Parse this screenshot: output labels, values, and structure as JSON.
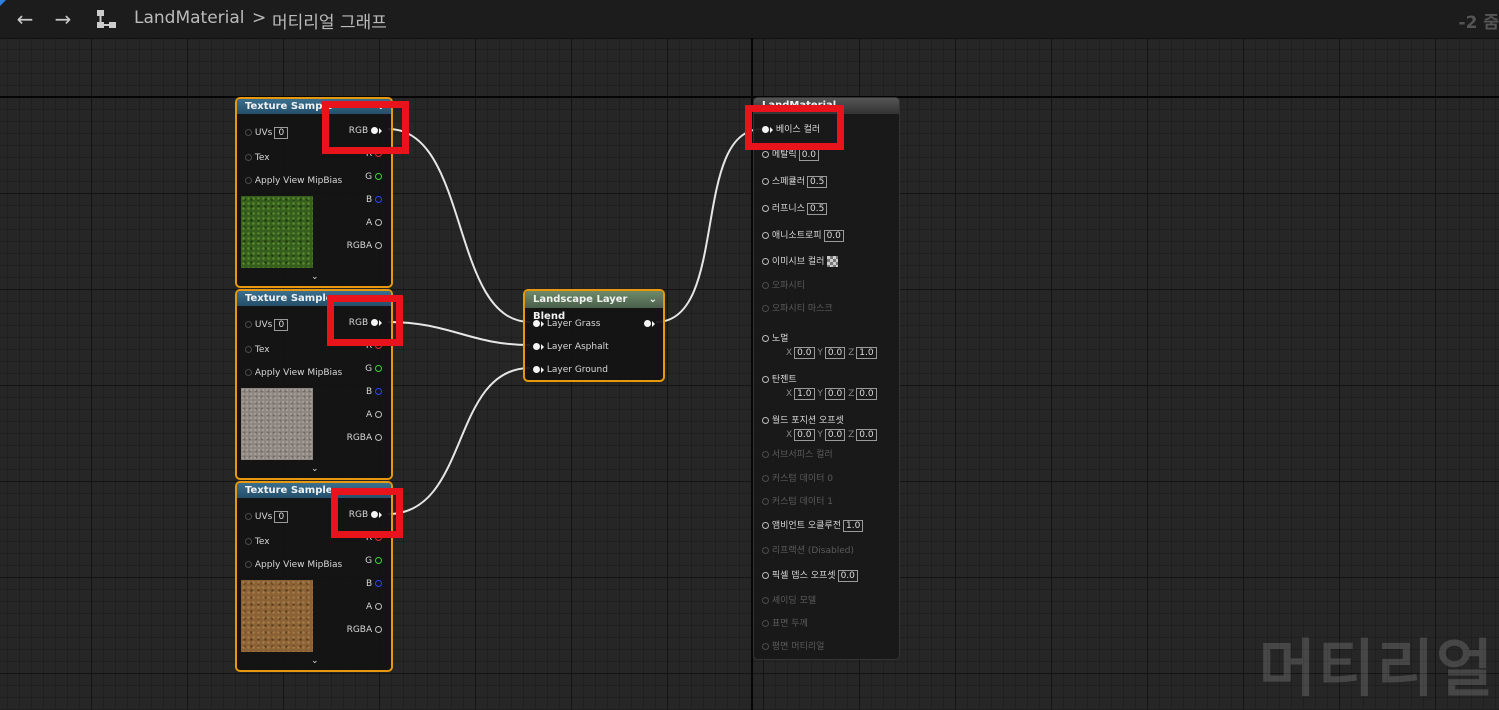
{
  "toolbar": {
    "back_icon": "back-arrow-icon",
    "forward_icon": "forward-arrow-icon",
    "graph_icon": "graph-icon",
    "breadcrumb_root": "LandMaterial",
    "breadcrumb_separator": ">",
    "breadcrumb_current": "머티리얼 그래프",
    "zoom_label": "-2 줌"
  },
  "texture_nodes": [
    {
      "title": "Texture Sample",
      "uvs_label": "UVs",
      "uvs_value": "0",
      "tex_label": "Tex",
      "mip_label": "Apply View MipBias",
      "out_rgb": "RGB",
      "out_r": "R",
      "out_g": "G",
      "out_b": "B",
      "out_a": "A",
      "out_rgba": "RGBA",
      "texture": "grass"
    },
    {
      "title": "Texture Sample",
      "uvs_label": "UVs",
      "uvs_value": "0",
      "tex_label": "Tex",
      "mip_label": "Apply View MipBias",
      "out_rgb": "RGB",
      "out_r": "R",
      "out_g": "G",
      "out_b": "B",
      "out_a": "A",
      "out_rgba": "RGBA",
      "texture": "asphalt"
    },
    {
      "title": "Texture Sample",
      "uvs_label": "UVs",
      "uvs_value": "0",
      "tex_label": "Tex",
      "mip_label": "Apply View MipBias",
      "out_rgb": "RGB",
      "out_r": "R",
      "out_g": "G",
      "out_b": "B",
      "out_a": "A",
      "out_rgba": "RGBA",
      "texture": "ground"
    }
  ],
  "blend_node": {
    "title": "Landscape Layer Blend",
    "layers": [
      "Layer Grass",
      "Layer Asphalt",
      "Layer Ground"
    ]
  },
  "material_node": {
    "title": "LandMaterial",
    "pins": [
      {
        "label": "베이스 컬러",
        "value": "",
        "enabled": true
      },
      {
        "label": "메탈릭",
        "value": "0.0",
        "enabled": true
      },
      {
        "label": "스페큘러",
        "value": "0.5",
        "enabled": true
      },
      {
        "label": "러프니스",
        "value": "0.5",
        "enabled": true
      },
      {
        "label": "애니소트로피",
        "value": "0.0",
        "enabled": true
      },
      {
        "label": "이미시브 컬러",
        "value": "",
        "enabled": true
      },
      {
        "label": "오파시티",
        "value": "",
        "enabled": false
      },
      {
        "label": "오파시티 마스크",
        "value": "",
        "enabled": false
      },
      {
        "label": "노멀",
        "x": "0.0",
        "y": "0.0",
        "z": "1.0",
        "enabled": true
      },
      {
        "label": "탄젠트",
        "x": "1.0",
        "y": "0.0",
        "z": "0.0",
        "enabled": true
      },
      {
        "label": "월드 포지션 오프셋",
        "x": "0.0",
        "y": "0.0",
        "z": "0.0",
        "enabled": true
      },
      {
        "label": "서브서피스 컬러",
        "value": "",
        "enabled": false
      },
      {
        "label": "커스텀 데이터 0",
        "value": "",
        "enabled": false
      },
      {
        "label": "커스텀 데이터 1",
        "value": "",
        "enabled": false
      },
      {
        "label": "앰비언트 오클루전",
        "value": "1.0",
        "enabled": true
      },
      {
        "label": "리프랙션 (Disabled)",
        "value": "",
        "enabled": false
      },
      {
        "label": "픽셀 뎁스 오프셋",
        "value": "0.0",
        "enabled": true
      },
      {
        "label": "셰이딩 모델",
        "value": "",
        "enabled": false
      },
      {
        "label": "표면 두께",
        "value": "",
        "enabled": false
      },
      {
        "label": "평면 머티리얼",
        "value": "",
        "enabled": false
      }
    ],
    "axis_x": "X",
    "axis_y": "Y",
    "axis_z": "Z"
  },
  "watermark": "머티리얼",
  "colors": {
    "node_border": "#e8980c",
    "highlight": "#e8131b",
    "header_blue": "#2f5f7f",
    "header_green": "#5c7a58"
  }
}
